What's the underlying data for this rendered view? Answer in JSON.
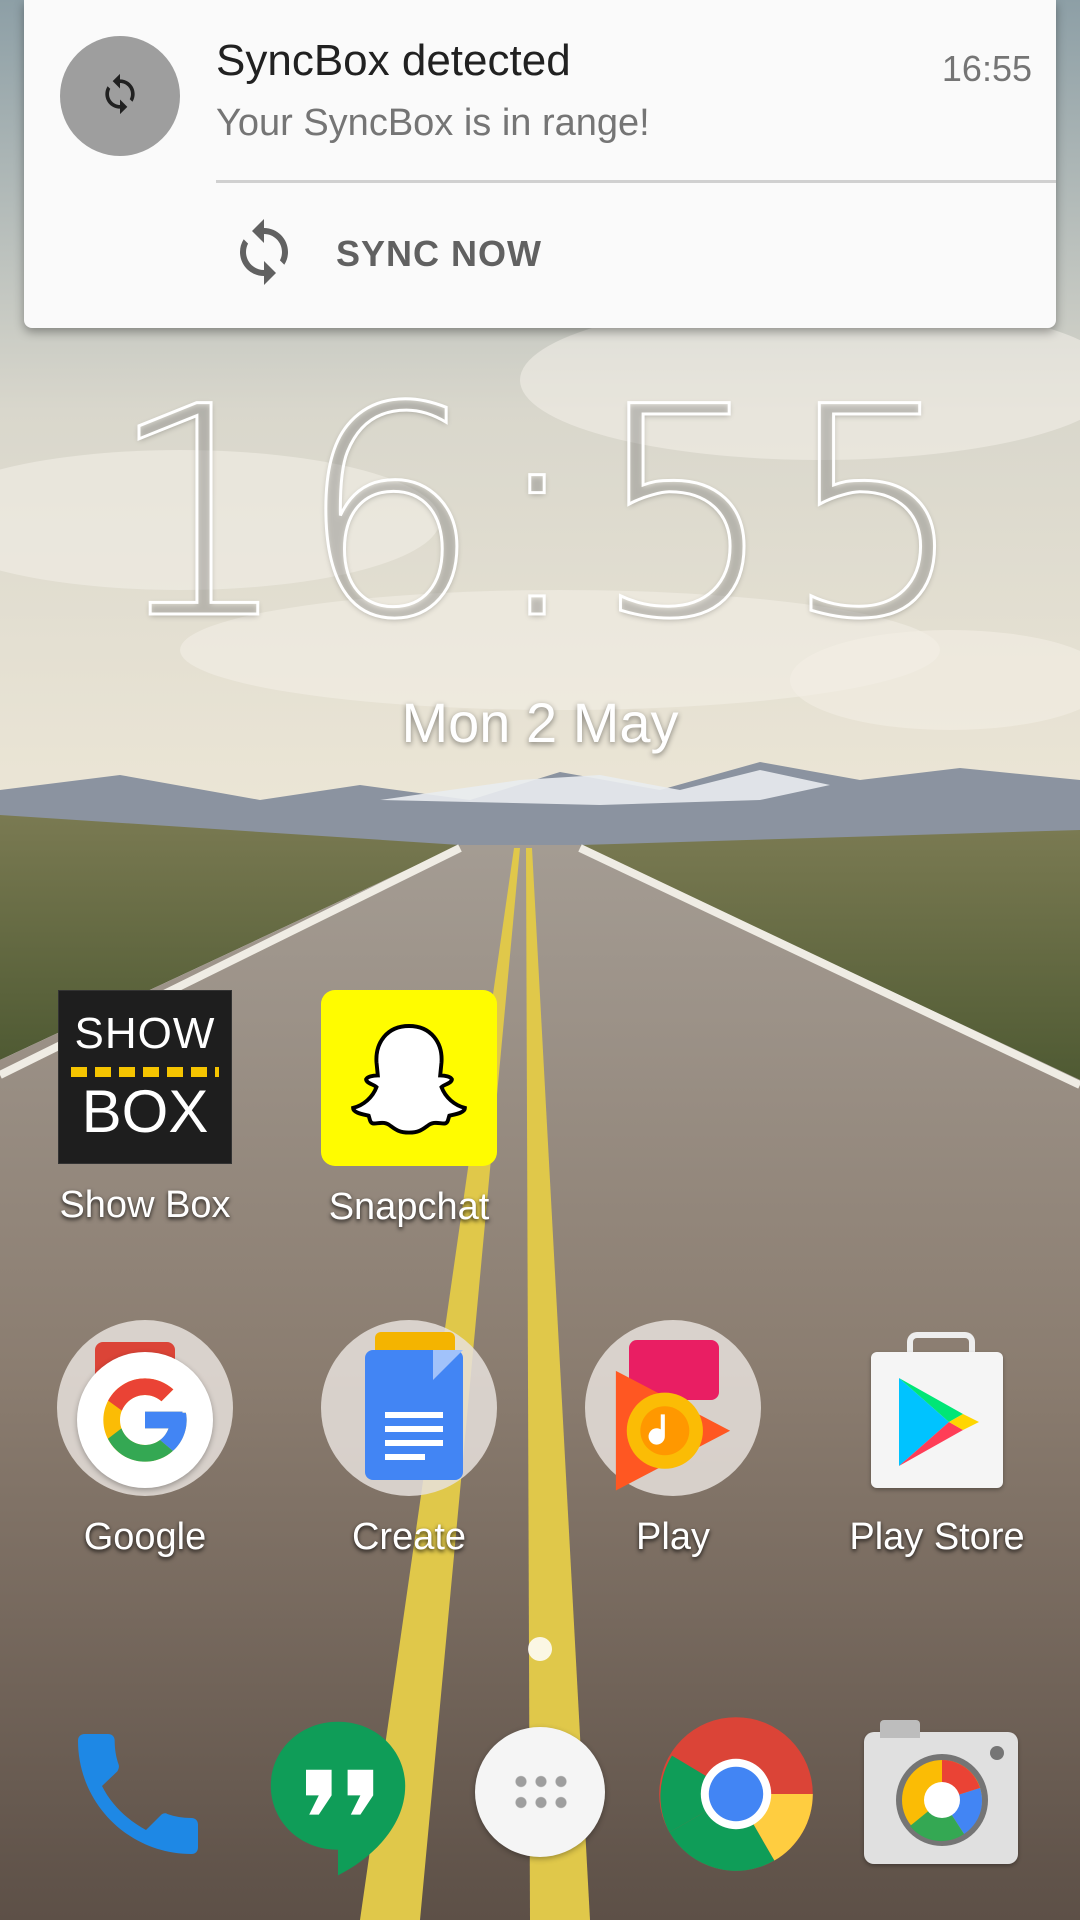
{
  "notification": {
    "title": "SyncBox detected",
    "time": "16:55",
    "text": "Your SyncBox is in range!",
    "action_label": "SYNC NOW"
  },
  "clock": {
    "time": "16:55",
    "date": "Mon 2 May"
  },
  "home_apps": {
    "row1": [
      {
        "label": "Show Box",
        "icon": "showbox-icon"
      },
      {
        "label": "Snapchat",
        "icon": "snapchat-icon"
      }
    ],
    "row2": [
      {
        "label": "Google",
        "icon": "google-folder-icon"
      },
      {
        "label": "Create",
        "icon": "docs-folder-icon"
      },
      {
        "label": "Play",
        "icon": "play-folder-icon"
      },
      {
        "label": "Play Store",
        "icon": "play-store-icon"
      }
    ],
    "showbox_text": [
      "SHOW",
      "BOX"
    ]
  },
  "dock": [
    {
      "icon": "phone-icon"
    },
    {
      "icon": "hangouts-icon"
    },
    {
      "icon": "app-drawer-icon"
    },
    {
      "icon": "chrome-icon"
    },
    {
      "icon": "camera-icon"
    }
  ],
  "colors": {
    "notification_bg": "#fafafa",
    "snapchat_yellow": "#fffc00",
    "google_blue": "#4285f4",
    "google_red": "#ea4335",
    "google_yellow": "#fbbc05",
    "google_green": "#34a853"
  }
}
